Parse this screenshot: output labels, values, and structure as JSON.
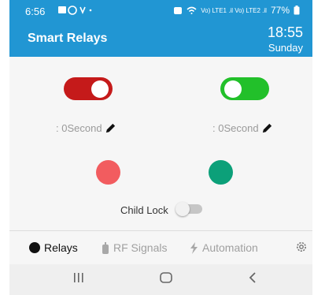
{
  "status_bar": {
    "time": "6:56",
    "network_label": "Vo) LTE1 .il Vo) LTE2 .il",
    "battery": "77%"
  },
  "app_bar": {
    "title": "Smart Relays",
    "clock": "18:55",
    "day": "Sunday"
  },
  "relays": [
    {
      "state": "on",
      "color": "#c51a1a",
      "timer_label": ": 0Second"
    },
    {
      "state": "off",
      "color": "#22c02a",
      "timer_label": ": 0Second"
    }
  ],
  "indicators": [
    {
      "color": "#f25c5f"
    },
    {
      "color": "#0ca079"
    }
  ],
  "child_lock": {
    "label": "Child Lock",
    "state": "off"
  },
  "tabs": [
    {
      "label": "Relays",
      "active": true,
      "icon": "circle-icon"
    },
    {
      "label": "RF Signals",
      "active": false,
      "icon": "remote-icon"
    },
    {
      "label": "Automation",
      "active": false,
      "icon": "lightning-icon"
    },
    {
      "label": "",
      "active": false,
      "icon": "gear-icon"
    }
  ],
  "nav_bar": {
    "icons": [
      "recent-apps-icon",
      "home-icon",
      "back-icon"
    ]
  },
  "colors": {
    "primary": "#2196d3"
  }
}
